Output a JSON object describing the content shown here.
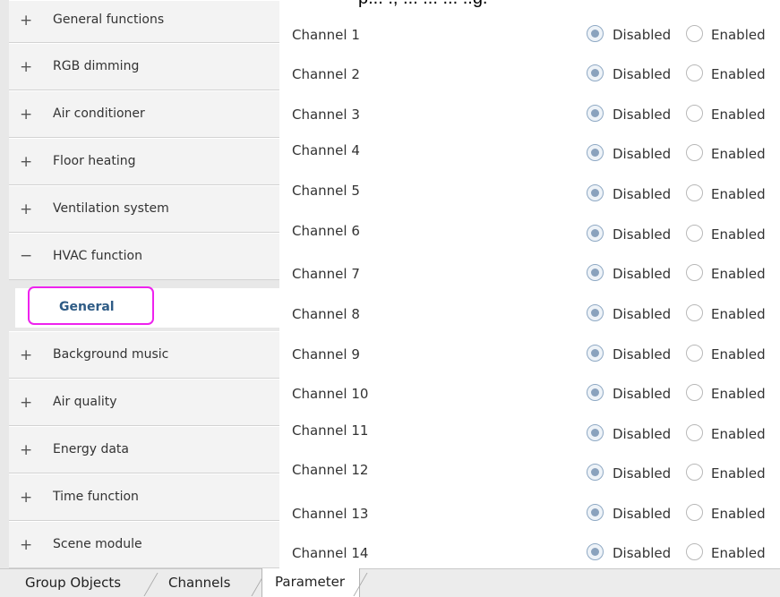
{
  "clipped_heading": "p... ., ... ... ... ..g.",
  "sidebar": {
    "items": [
      {
        "sign": "+",
        "label": "General functions"
      },
      {
        "sign": "+",
        "label": "RGB dimming"
      },
      {
        "sign": "+",
        "label": "Air conditioner"
      },
      {
        "sign": "+",
        "label": "Floor heating"
      },
      {
        "sign": "+",
        "label": "Ventilation system"
      },
      {
        "sign": "−",
        "label": "HVAC function"
      },
      {
        "sign": "+",
        "label": "Background music"
      },
      {
        "sign": "+",
        "label": "Air quality"
      },
      {
        "sign": "+",
        "label": "Energy data"
      },
      {
        "sign": "+",
        "label": "Time function"
      },
      {
        "sign": "+",
        "label": "Scene module"
      }
    ],
    "sub_item": {
      "label": "General"
    }
  },
  "parameters": {
    "option_disabled": "Disabled",
    "option_enabled": "Enabled",
    "channels": [
      {
        "label": "Channel 1",
        "value": "Disabled"
      },
      {
        "label": "Channel 2",
        "value": "Disabled"
      },
      {
        "label": "Channel 3",
        "value": "Disabled"
      },
      {
        "label": "Channel 4",
        "value": "Disabled"
      },
      {
        "label": "Channel 5",
        "value": "Disabled"
      },
      {
        "label": "Channel 6",
        "value": "Disabled"
      },
      {
        "label": "Channel 7",
        "value": "Disabled"
      },
      {
        "label": "Channel 8",
        "value": "Disabled"
      },
      {
        "label": "Channel 9",
        "value": "Disabled"
      },
      {
        "label": "Channel 10",
        "value": "Disabled"
      },
      {
        "label": "Channel 11",
        "value": "Disabled"
      },
      {
        "label": "Channel 12",
        "value": "Disabled"
      },
      {
        "label": "Channel 13",
        "value": "Disabled"
      },
      {
        "label": "Channel 14",
        "value": "Disabled"
      }
    ]
  },
  "tabs": [
    {
      "label": "Group Objects",
      "active": false
    },
    {
      "label": "Channels",
      "active": false
    },
    {
      "label": "Parameter",
      "active": true
    }
  ],
  "colors": {
    "highlight_border": "#ee22ee",
    "selected_item_text": "#2e5b85"
  }
}
